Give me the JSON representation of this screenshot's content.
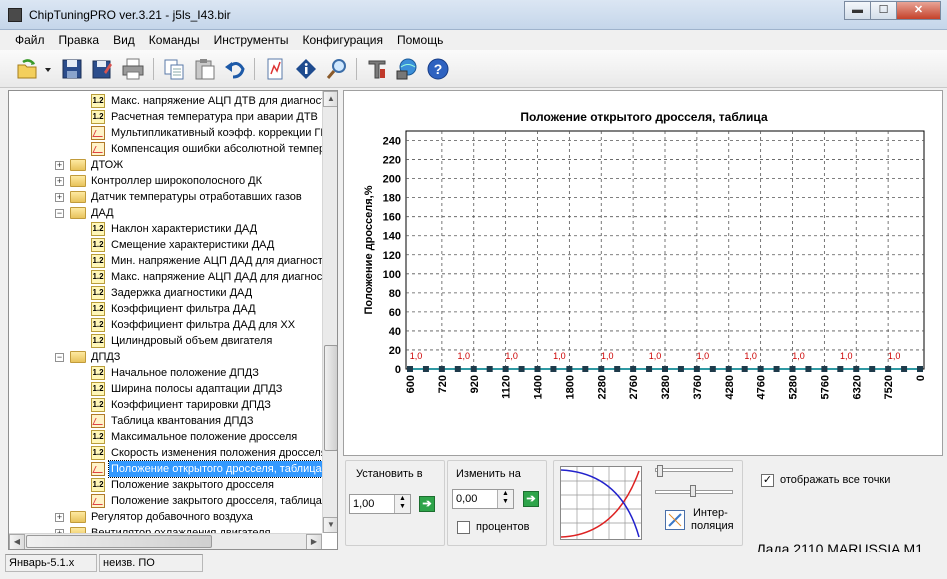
{
  "window": {
    "title": "ChipTuningPRO ver.3.21 - j5ls_I43.bir",
    "minimize": "▬",
    "maximize": "☐",
    "close": "✕"
  },
  "menu": [
    "Файл",
    "Правка",
    "Вид",
    "Команды",
    "Инструменты",
    "Конфигурация",
    "Помощь"
  ],
  "toolbar": {
    "icons": [
      "open-icon",
      "open-dropdown-icon",
      "save-icon",
      "save-as-icon",
      "print-icon",
      "copy-icon",
      "paste-icon",
      "undo-icon",
      "compare-icon",
      "info-icon",
      "search-icon",
      "settings-icon",
      "network-icon",
      "help-icon"
    ]
  },
  "tree": {
    "items": [
      {
        "label": "Макс. напряжение АЦП ДТВ для диагностики",
        "icon": "param-icon",
        "level": 3
      },
      {
        "label": "Расчетная температура при аварии ДТВ",
        "icon": "param-icon",
        "level": 3
      },
      {
        "label": "Мультипликативный коэфф. коррекции ГВЦ",
        "icon": "table-icon",
        "level": 3
      },
      {
        "label": "Компенсация ошибки абсолютной температуры",
        "icon": "table-icon",
        "level": 3
      },
      {
        "label": "ДТОЖ",
        "icon": "folder-icon",
        "level": 2,
        "expander": "+"
      },
      {
        "label": "Контроллер широкополосного ДК",
        "icon": "folder-icon",
        "level": 2,
        "expander": "+"
      },
      {
        "label": "Датчик температуры отработавших газов",
        "icon": "folder-icon",
        "level": 2,
        "expander": "+"
      },
      {
        "label": "ДАД",
        "icon": "folder-open-icon",
        "level": 2,
        "expander": "−"
      },
      {
        "label": "Наклон характеристики ДАД",
        "icon": "param-icon",
        "level": 3
      },
      {
        "label": "Смещение характеристики ДАД",
        "icon": "param-icon",
        "level": 3
      },
      {
        "label": "Мин. напряжение АЦП ДАД для диагностики",
        "icon": "param-icon",
        "level": 3
      },
      {
        "label": "Макс. напряжение АЦП ДАД для диагностики",
        "icon": "param-icon",
        "level": 3
      },
      {
        "label": "Задержка диагностики ДАД",
        "icon": "param-icon",
        "level": 3
      },
      {
        "label": "Коэффициент фильтра ДАД",
        "icon": "param-icon",
        "level": 3
      },
      {
        "label": "Коэффициент фильтра ДАД для ХХ",
        "icon": "param-icon",
        "level": 3
      },
      {
        "label": "Цилиндровый объем двигателя",
        "icon": "param-icon",
        "level": 3
      },
      {
        "label": "ДПДЗ",
        "icon": "folder-open-icon",
        "level": 2,
        "expander": "−"
      },
      {
        "label": "Начальное положение ДПДЗ",
        "icon": "param-icon",
        "level": 3
      },
      {
        "label": "Ширина полосы адаптации ДПДЗ",
        "icon": "param-icon",
        "level": 3
      },
      {
        "label": "Коэффициент тарировки ДПДЗ",
        "icon": "param-icon",
        "level": 3
      },
      {
        "label": "Таблица квантования ДПДЗ",
        "icon": "table-icon",
        "level": 3
      },
      {
        "label": "Максимальное положение дросселя",
        "icon": "param-icon",
        "level": 3
      },
      {
        "label": "Скорость изменения положения дросселя",
        "icon": "param-icon",
        "level": 3
      },
      {
        "label": "Положение открытого дросселя, таблица",
        "icon": "table-icon",
        "level": 3,
        "selected": true
      },
      {
        "label": "Положение закрытого дросселя",
        "icon": "param-icon",
        "level": 3
      },
      {
        "label": "Положение закрытого дросселя, таблица",
        "icon": "table-icon",
        "level": 3
      },
      {
        "label": "Регулятор добавочного воздуха",
        "icon": "folder-icon",
        "level": 2,
        "expander": "+"
      },
      {
        "label": "Вентилятор охлаждения двигателя",
        "icon": "folder-icon",
        "level": 2,
        "expander": "+"
      }
    ]
  },
  "chart_data": {
    "type": "line",
    "title": "Положение открытого дросселя, таблица",
    "ylabel": "Положение дросселя,%",
    "xlabel": "",
    "ylim": [
      0,
      250
    ],
    "yticks": [
      0,
      20,
      40,
      60,
      80,
      100,
      120,
      140,
      160,
      180,
      200,
      220,
      240
    ],
    "x": [
      600,
      720,
      840,
      920,
      1000,
      1120,
      1240,
      1400,
      1600,
      1800,
      2040,
      2280,
      2520,
      2760,
      3000,
      3280,
      3520,
      3760,
      4040,
      4280,
      4520,
      4760,
      5040,
      5280,
      5520,
      5760,
      6000,
      6320,
      6640,
      7000,
      7520,
      8000,
      8000
    ],
    "xticklabels": [
      "600",
      "720",
      "920",
      "1120",
      "1400",
      "1800",
      "2280",
      "2760",
      "3280",
      "3760",
      "4280",
      "4760",
      "5280",
      "5760",
      "6320",
      "7520",
      "0"
    ],
    "values": [
      0,
      0,
      0,
      0,
      0,
      0,
      0,
      0,
      0,
      0,
      0,
      0,
      0,
      0,
      0,
      0,
      0,
      0,
      0,
      0,
      0,
      0,
      0,
      0,
      0,
      0,
      0,
      0,
      0,
      0,
      0,
      0,
      0
    ],
    "point_label": "1,0",
    "grid": true,
    "legend": "none"
  },
  "controls": {
    "set_label": "Установить в",
    "set_value": "1,00",
    "change_label": "Изменить на",
    "change_value": "0,00",
    "percent_label": "процентов",
    "interp_label_1": "Интер-",
    "interp_label_2": "поляция",
    "show_all_points": "отображать все точки",
    "go_glyph": "➔",
    "check_glyph": "✓",
    "spin_up": "▲",
    "spin_down": "▼"
  },
  "status": {
    "left": "Январь-5.1.х",
    "middle": "неизв. ПО",
    "vehicle": "Лада 2110 MARUSSIA M1"
  },
  "colors": {
    "selection": "#3399ff",
    "series_line": "#2f9aa4",
    "series_point": "#1e3a4a",
    "point_label": "#cc0000",
    "grid": "#555555"
  }
}
